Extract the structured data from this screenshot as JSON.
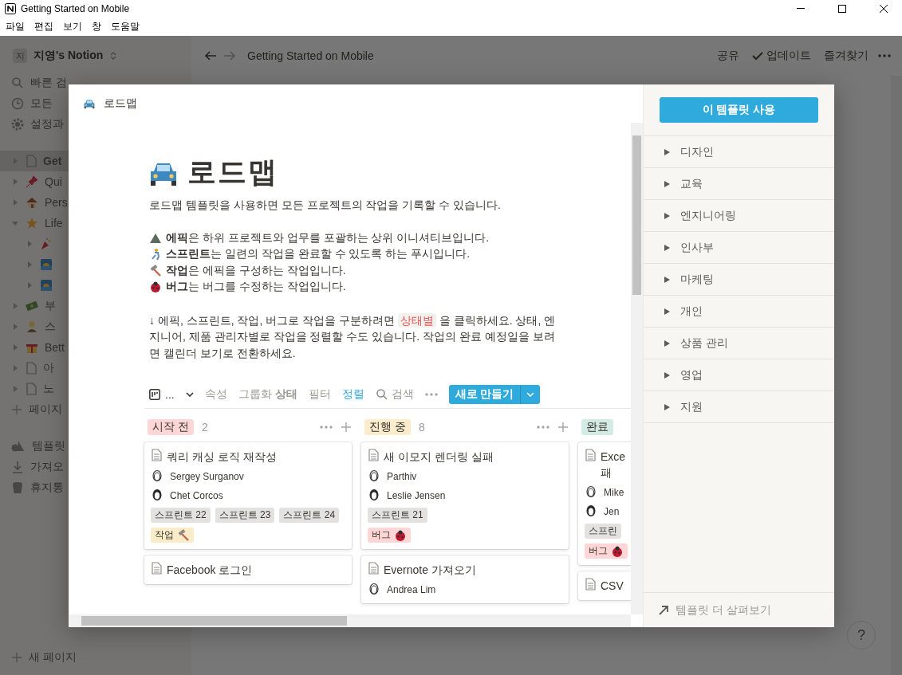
{
  "window": {
    "title": "Getting Started on Mobile",
    "menu": [
      "파일",
      "편집",
      "보기",
      "창",
      "도움말"
    ]
  },
  "sidebar": {
    "workspace_initial": "지",
    "workspace": "지영's Notion",
    "actions": [
      {
        "kind": "search",
        "label": "빠른 검"
      },
      {
        "kind": "clock",
        "label": "모든"
      },
      {
        "kind": "gear",
        "label": "설정과"
      }
    ],
    "tree": [
      {
        "kind": "page",
        "label": "Get",
        "selected": true,
        "expanded": false
      },
      {
        "kind": "pin",
        "label": "Qui",
        "selected": false,
        "expanded": false
      },
      {
        "kind": "house",
        "label": "Pers",
        "selected": false,
        "expanded": false
      },
      {
        "kind": "star",
        "label": "Life",
        "selected": false,
        "expanded": true,
        "children": [
          {
            "kind": "party",
            "selected": false,
            "expanded": false
          },
          {
            "kind": "sunset",
            "selected": false,
            "expanded": false
          },
          {
            "kind": "sunset",
            "selected": false,
            "expanded": false
          }
        ]
      },
      {
        "kind": "money",
        "label": "부",
        "selected": false,
        "expanded": false
      },
      {
        "kind": "person",
        "label": "스",
        "selected": false,
        "expanded": false
      },
      {
        "kind": "gift",
        "label": "Bett",
        "selected": false,
        "expanded": false
      },
      {
        "kind": "page",
        "label": "아",
        "selected": false,
        "expanded": false
      },
      {
        "kind": "page",
        "label": "노",
        "selected": false,
        "expanded": false
      }
    ],
    "add_page": "페이지",
    "tools": [
      {
        "kind": "shapes",
        "label": "템플릿"
      },
      {
        "kind": "download",
        "label": "가져오"
      },
      {
        "kind": "trash",
        "label": "휴지통"
      }
    ],
    "new_page": "새 페이지"
  },
  "topbar": {
    "breadcrumb": "Getting Started on Mobile",
    "actions": [
      {
        "kind": "text",
        "label": "공유"
      },
      {
        "kind": "check",
        "label": "업데이트"
      },
      {
        "kind": "text",
        "label": "즐겨찾기"
      }
    ]
  },
  "help": "?",
  "template_preview": {
    "breadcrumb": "로드맵",
    "title": "로드맵",
    "intro": "로드맵 템플릿을 사용하면 모든 프로젝트의 작업을 기록할 수 있습니다.",
    "definitions": [
      {
        "kind": "epic",
        "text": "**에픽**은 하위 프로젝트와 업무를 포괄하는 상위 이니셔티브입니다."
      },
      {
        "kind": "sprint",
        "text": "**스프린트**는 일련의 작업을 완료할 수 있도록 하는 푸시입니다."
      },
      {
        "kind": "task",
        "text": "**작업**은 에픽을 구성하는 작업입니다."
      },
      {
        "kind": "bug",
        "text": "**버그**는 버그를 수정하는 작업입니다."
      }
    ],
    "note": {
      "before": "↓ 에픽, 스프린트, 작업, 버그로 작업을 구분하려면",
      "code": "상태별",
      "after": "을 클릭하세요. 상태, 엔지니어, 제품 관리자별로 작업을 정렬할 수도 있습니다. 작업의 완료 예정일을 보려면 캘린더 보기로 전환하세요."
    },
    "board": {
      "view": "...",
      "controls": [
        {
          "kind": "text",
          "label": "속성",
          "active": false
        },
        {
          "kind": "text",
          "label": "그룹화 **상태**",
          "active": false
        },
        {
          "kind": "text",
          "label": "필터",
          "active": false
        },
        {
          "kind": "text",
          "label": "정렬",
          "active": true
        },
        {
          "kind": "search",
          "label": "검색",
          "active": false
        }
      ],
      "new_button": "새로 만들기",
      "columns": [
        {
          "label": "시작 전",
          "count": "2",
          "color": "#ffd6d6",
          "cards": [
            {
              "title": [
                "쿼리 캐싱 로직 재작성"
              ],
              "people": [
                "Sergey Surganov",
                "Chet Corcos"
              ],
              "tags": [
                {
                  "kind": "sprint",
                  "label": "스프린트 22",
                  "color": "#e3e2e0"
                },
                {
                  "kind": "sprint",
                  "label": "스프린트 23",
                  "color": "#e3e2e0"
                },
                {
                  "kind": "sprint",
                  "label": "스프린트 24",
                  "color": "#e3e2e0"
                },
                {
                  "kind": "task",
                  "label": "작업",
                  "color": "#fbecc9"
                }
              ]
            },
            {
              "title": [
                "Facebook 로그인"
              ]
            }
          ]
        },
        {
          "label": "진행 중",
          "count": "8",
          "color": "#fbeccc",
          "cards": [
            {
              "title": [
                "새 이모지 렌더링 실패"
              ],
              "people": [
                "Parthiv",
                "Leslie Jensen"
              ],
              "tags": [
                {
                  "kind": "sprint",
                  "label": "스프린트 21",
                  "color": "#e3e2e0"
                },
                {
                  "kind": "bug",
                  "label": "버그",
                  "color": "#ffd6d6"
                }
              ]
            },
            {
              "title": [
                "Evernote 가져오기"
              ],
              "people": [
                "Andrea Lim"
              ]
            }
          ]
        },
        {
          "label": "완료",
          "color": "#d3ebe4",
          "cards": [
            {
              "title": [
                "Exce",
                "패"
              ],
              "people": [
                "Mike",
                "Jen"
              ],
              "tags": [
                {
                  "kind": "sprint",
                  "label": "스프린",
                  "color": "#e3e2e0"
                },
                {
                  "kind": "bug",
                  "label": "버그",
                  "color": "#ffd6d6"
                }
              ]
            },
            {
              "title": [
                "CSV"
              ]
            }
          ]
        }
      ]
    }
  },
  "template_panel": {
    "use_button": "이 템플릿 사용",
    "categories": [
      "디자인",
      "교육",
      "엔지니어링",
      "인사부",
      "마케팅",
      "개인",
      "상품 관리",
      "영업",
      "지원"
    ],
    "footer": "템플릿 더 살펴보기"
  }
}
